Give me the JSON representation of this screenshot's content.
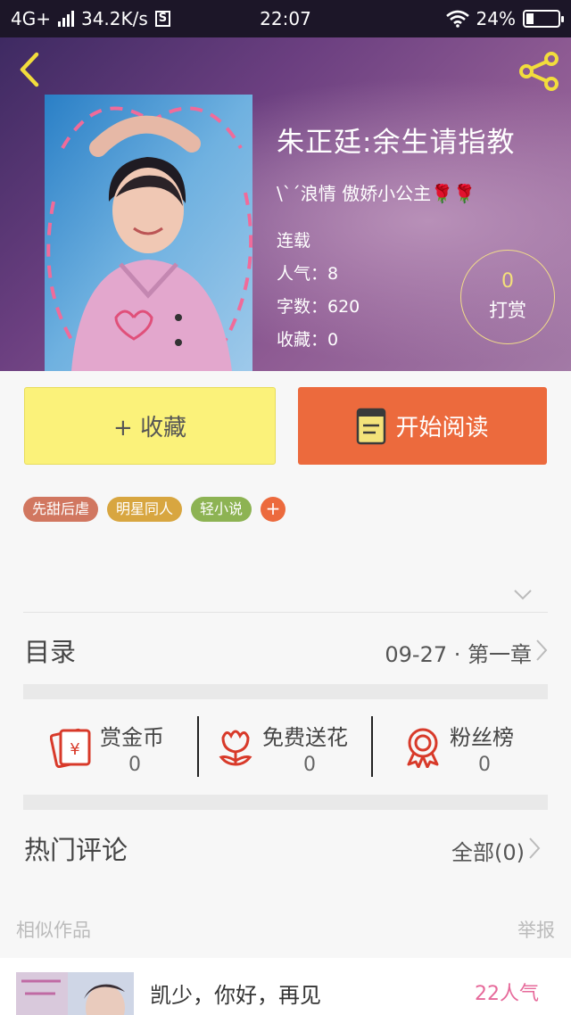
{
  "status_bar": {
    "network": "4G+",
    "speed": "34.2K/s",
    "s_badge": "S",
    "time": "22:07",
    "battery_text": "24%",
    "battery_level": 0.24
  },
  "header": {
    "back_icon": "chevron-left-icon",
    "share_icon": "share-icon",
    "accent": "#f2dd3c"
  },
  "book": {
    "title": "朱正廷:余生请指教",
    "author": "\\`´浪情 傲娇小公主🌹🌹",
    "status": "连载",
    "popularity": "人气：8",
    "word_count": "字数：620",
    "favorites": "收藏：0",
    "tip_count": "0",
    "tip_label": "打赏"
  },
  "actions": {
    "collect_label": "+ 收藏",
    "read_label": "开始阅读",
    "collect_color": "#fbf27a",
    "read_color": "#ec6a3d"
  },
  "tags": [
    {
      "label": "先甜后虐",
      "color": "#d17760"
    },
    {
      "label": "明星同人",
      "color": "#d8a640"
    },
    {
      "label": "轻小说",
      "color": "#8db353"
    }
  ],
  "tag_add": "+",
  "toc": {
    "title": "目录",
    "latest": "09-27 · 第一章"
  },
  "stats": [
    {
      "label": "赏金币",
      "value": "0",
      "icon": "red-envelope-icon"
    },
    {
      "label": "免费送花",
      "value": "0",
      "icon": "flower-icon"
    },
    {
      "label": "粉丝榜",
      "value": "0",
      "icon": "medal-icon"
    }
  ],
  "hot_comments": {
    "title": "热门评论",
    "all_label": "全部(0)"
  },
  "similar": {
    "title": "相似作品",
    "report": "举报",
    "items": [
      {
        "name": "凯少，你好，再见",
        "popularity": "22人气"
      }
    ]
  }
}
